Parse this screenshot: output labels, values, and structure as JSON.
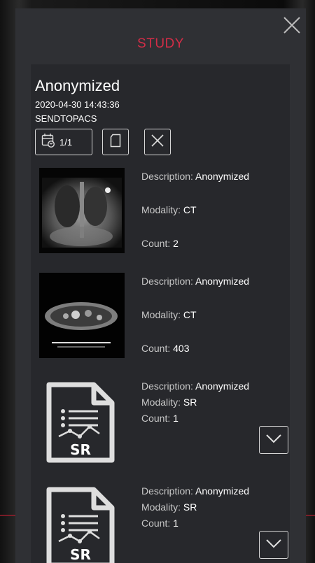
{
  "panel": {
    "title": "STUDY",
    "close_icon": "close-icon",
    "accent_color": "#d22d47"
  },
  "study": {
    "name": "Anonymized",
    "date": "2020-04-30 14:43:36",
    "destination": "SENDTOPACS",
    "toolbar": {
      "date_range_label": "1/1",
      "date_icon": "calendar-refresh-icon",
      "copy_icon": "copy-icon",
      "delete_icon": "close-icon"
    }
  },
  "series": [
    {
      "thumbnail": "chest-xray-image",
      "description_label": "Description:",
      "description": "Anonymized",
      "modality_label": "Modality:",
      "modality": "CT",
      "count_label": "Count:",
      "count": "2"
    },
    {
      "thumbnail": "ct-axial-image",
      "description_label": "Description:",
      "description": "Anonymized",
      "modality_label": "Modality:",
      "modality": "CT",
      "count_label": "Count:",
      "count": "403"
    },
    {
      "thumbnail": "sr-document-icon",
      "description_label": "Description:",
      "description": "Anonymized",
      "modality_label": "Modality:",
      "modality": "SR",
      "count_label": "Count:",
      "count": "1",
      "sr_label": "SR",
      "expand_icon": "chevron-down-icon"
    },
    {
      "thumbnail": "sr-document-icon",
      "description_label": "Description:",
      "description": "Anonymized",
      "modality_label": "Modality:",
      "modality": "SR",
      "count_label": "Count:",
      "count": "1",
      "sr_label": "SR",
      "expand_icon": "chevron-down-icon"
    }
  ]
}
